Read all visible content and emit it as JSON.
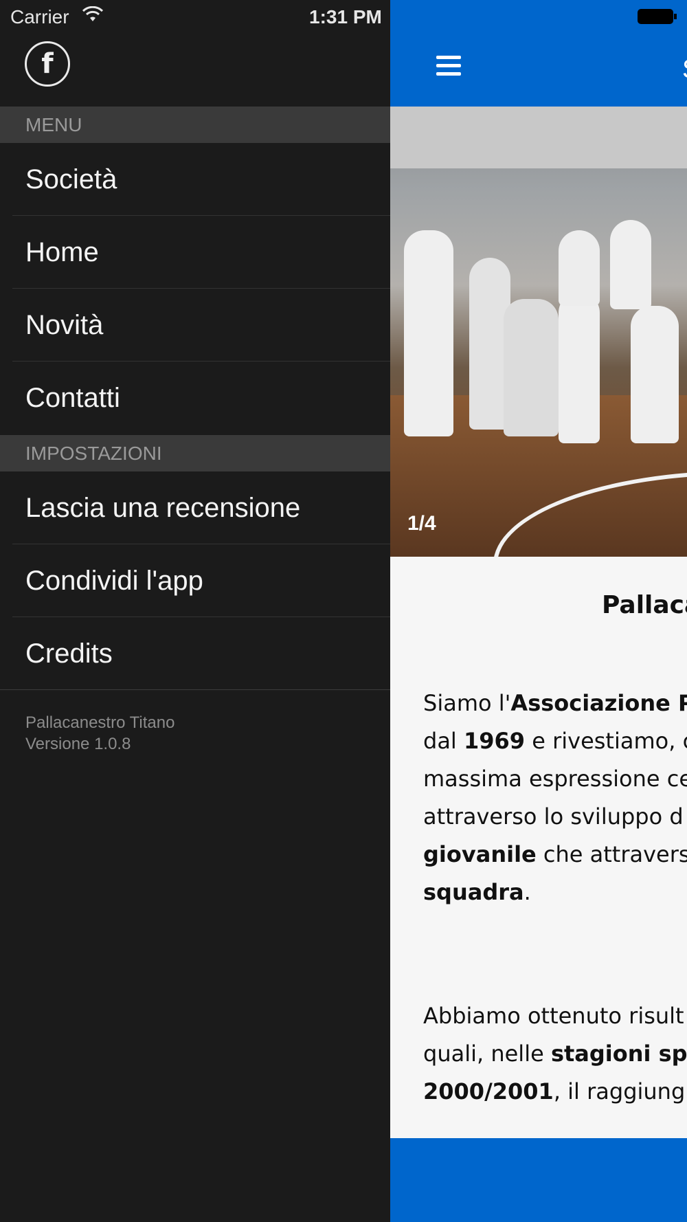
{
  "status": {
    "carrier": "Carrier",
    "time": "1:31 PM"
  },
  "menu": {
    "section_menu": "MENU",
    "items": [
      "Società",
      "Home",
      "Novità",
      "Contatti"
    ],
    "section_settings": "IMPOSTAZIONI",
    "settings_items": [
      "Lascia una recensione",
      "Condividi l'app",
      "Credits"
    ],
    "footer_name": "Pallacanestro Titano",
    "footer_version": "Versione 1.0.8"
  },
  "header": {
    "title_partial": "S"
  },
  "gallery": {
    "counter": "1/4"
  },
  "article": {
    "heading": "Pallaca",
    "p1": [
      [
        "Siamo l'",
        "Associazione Pa"
      ],
      [
        "dal ",
        "1969",
        " e rivestiamo, c"
      ],
      [
        "massima espressione ce"
      ],
      [
        "attraverso lo sviluppo d"
      ],
      [
        "giovanile",
        " che attraverso"
      ],
      [
        "squadra",
        "."
      ]
    ],
    "p2": [
      [
        "Abbiamo ottenuto risult"
      ],
      [
        "quali, nelle ",
        "stagioni spo"
      ],
      [
        "2000/2001",
        ", il raggiung"
      ]
    ]
  },
  "colors": {
    "accent": "#0066cc",
    "drawer_bg": "#1b1b1b",
    "section_bg": "#3a3a3a"
  },
  "icons": {
    "facebook": "facebook-icon",
    "menu": "hamburger-menu-icon",
    "wifi": "wifi-icon",
    "battery": "battery-icon"
  }
}
